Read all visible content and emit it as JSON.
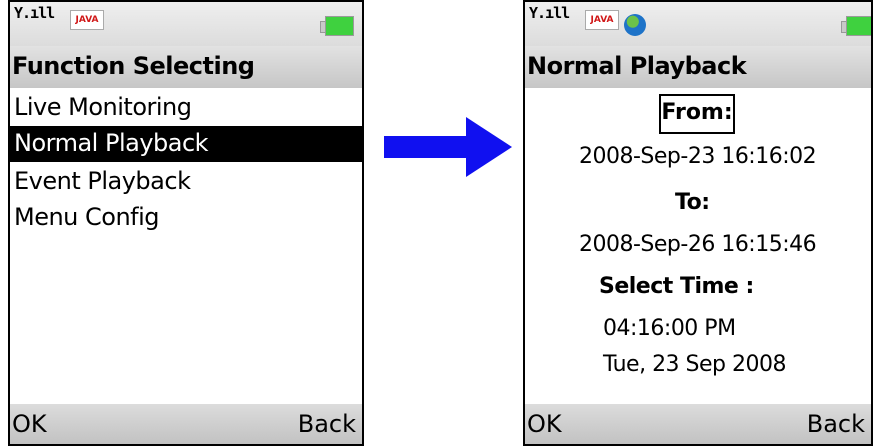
{
  "left_screen": {
    "status": {
      "signal": "Y.ıll",
      "java_badge": "JAVA"
    },
    "title": "Function Selecting",
    "menu_items": [
      {
        "label": "Live Monitoring"
      },
      {
        "label": "Normal Playback",
        "selected": true
      },
      {
        "label": "Event Playback"
      },
      {
        "label": "Menu Config"
      }
    ],
    "softkeys": {
      "left": "OK",
      "right": "Back"
    }
  },
  "right_screen": {
    "status": {
      "signal": "Y.ıll",
      "java_badge": "JAVA",
      "globe_icon": "globe-icon"
    },
    "title": "Normal Playback",
    "from_label": "From:",
    "from_value": "2008-Sep-23  16:16:02",
    "to_label": "To:",
    "to_value": "2008-Sep-26  16:15:46",
    "select_label": "Select Time :",
    "select_time": "04:16:00 PM",
    "select_date": "Tue, 23 Sep 2008",
    "softkeys": {
      "left": "OK",
      "right": "Back"
    }
  },
  "arrow": {
    "color": "#1010f0",
    "icon": "right-arrow-icon"
  },
  "colors": {
    "selection": "#000000",
    "battery": "#3fd13f"
  }
}
